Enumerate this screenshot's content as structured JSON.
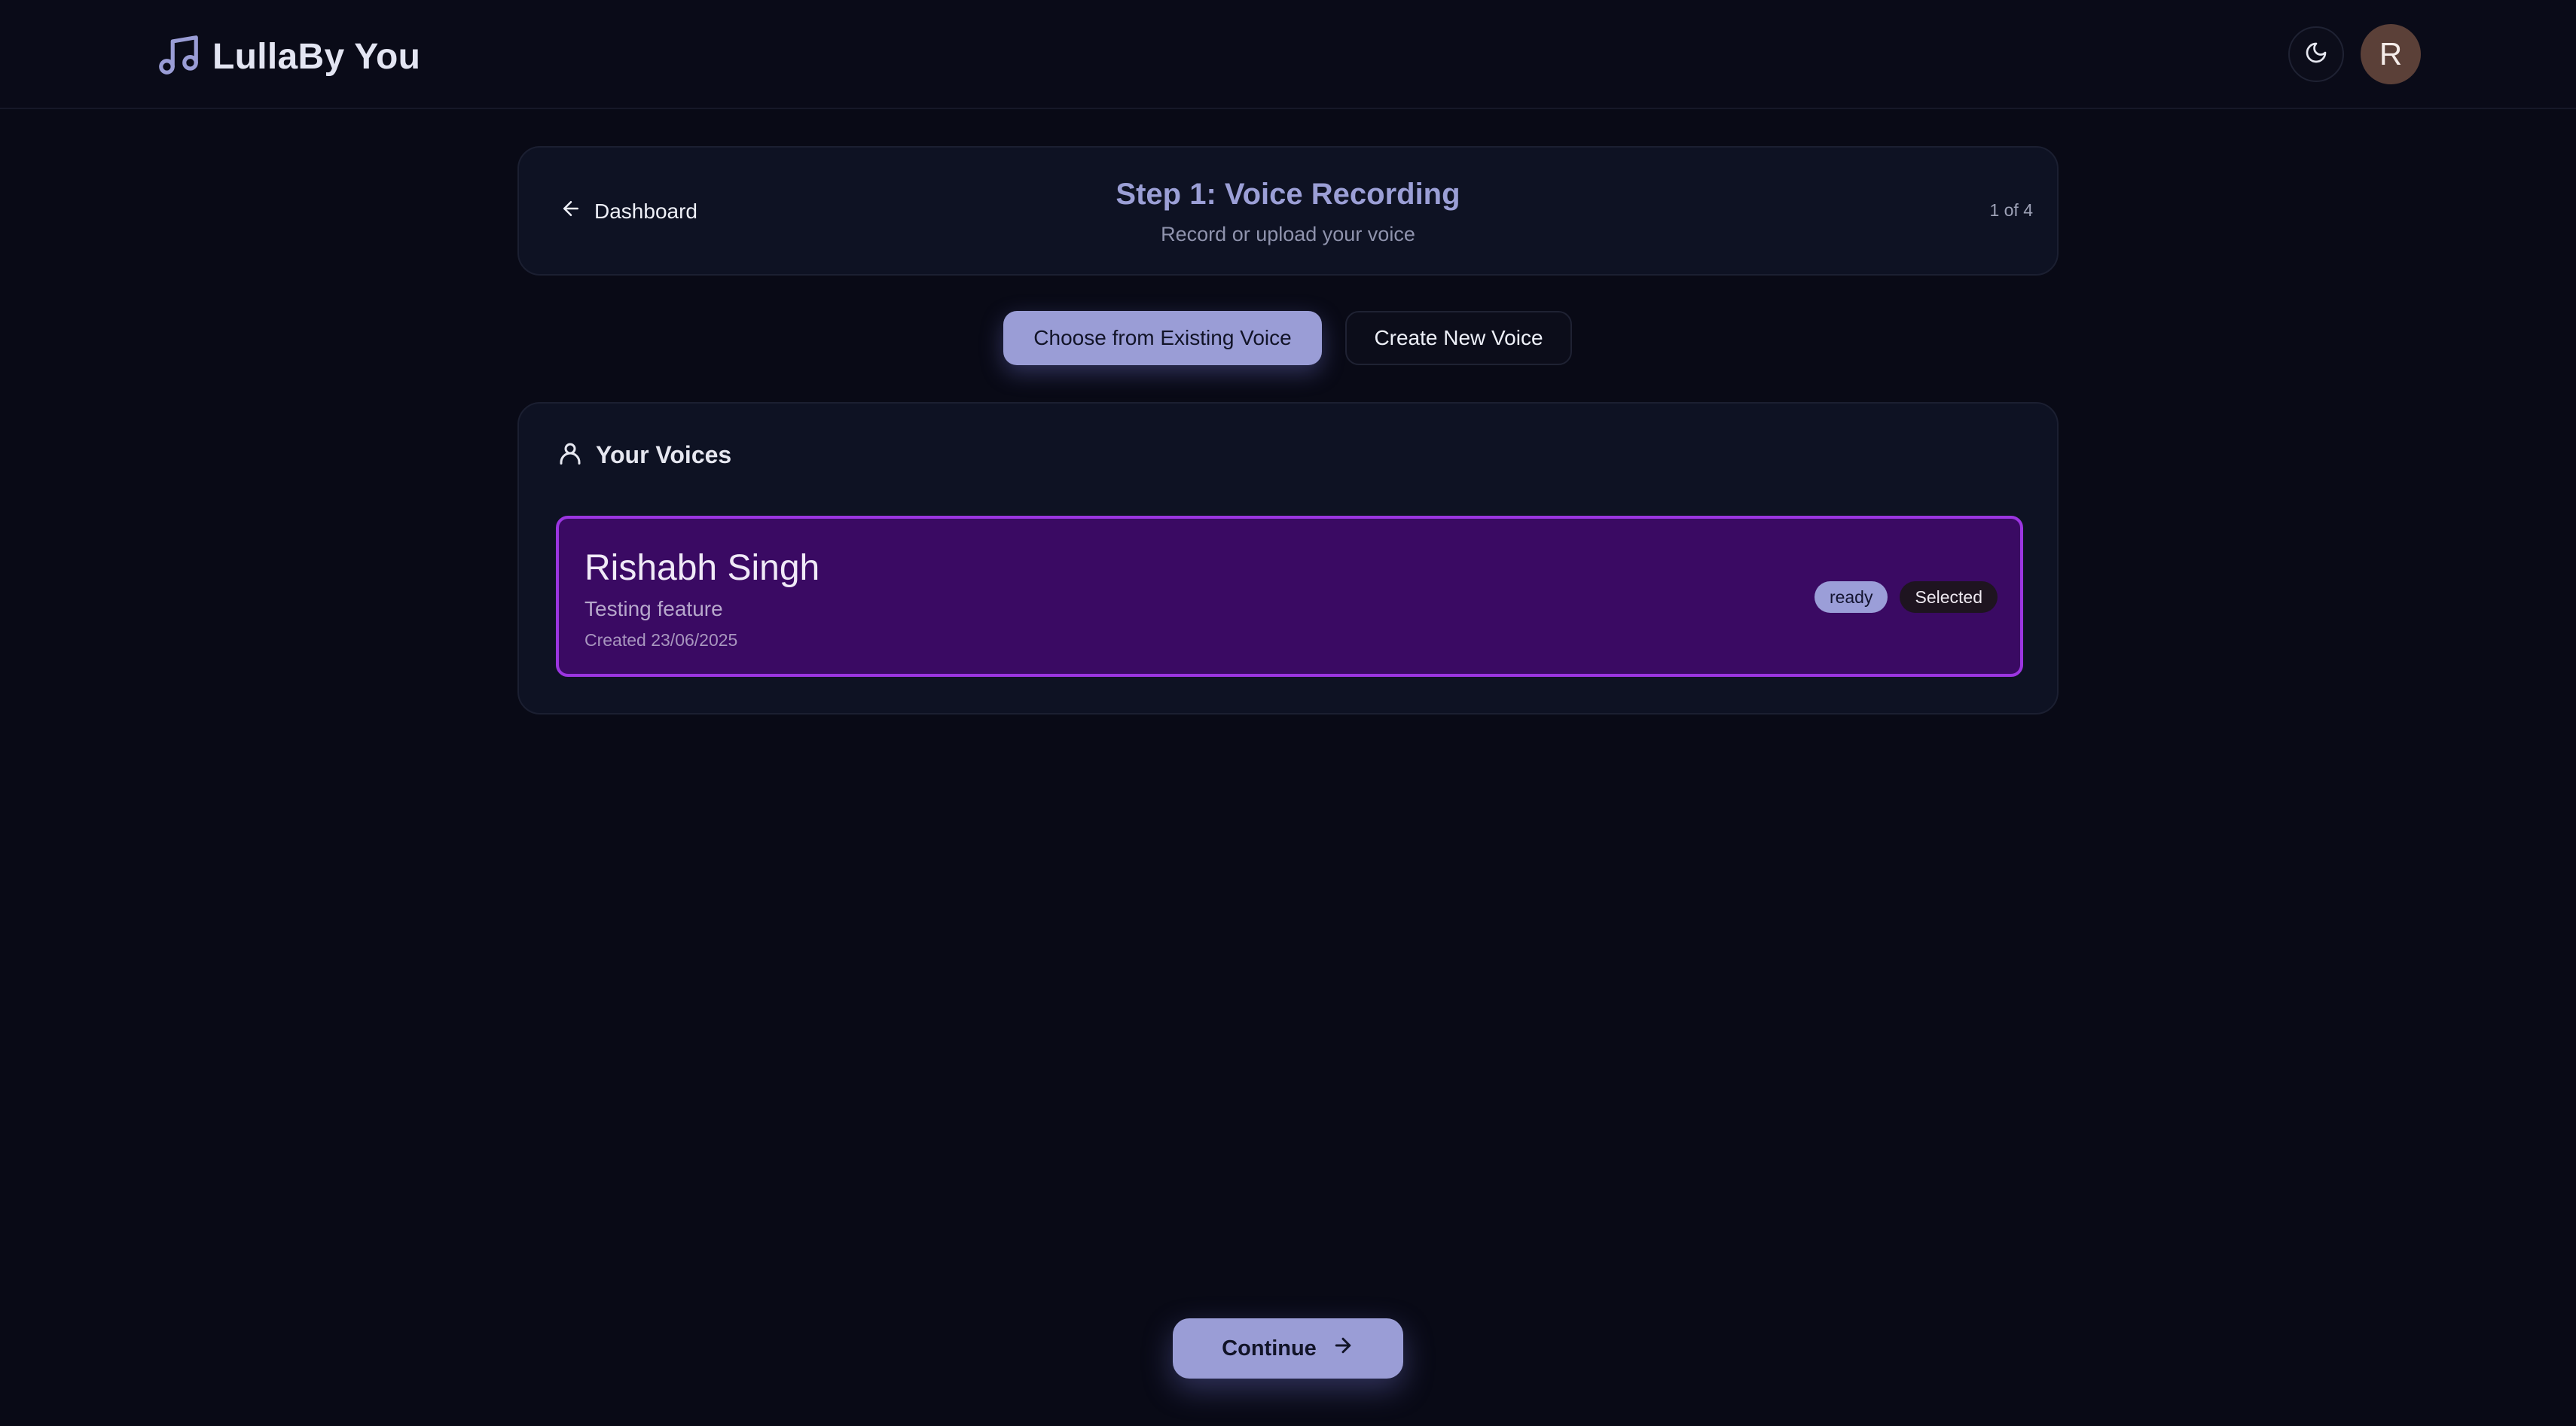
{
  "app": {
    "name": "LullaBy You",
    "avatar_initial": "R"
  },
  "header": {
    "icons": [
      "music-notes-icon",
      "moon-icon"
    ]
  },
  "step": {
    "back_label": "Dashboard",
    "title": "Step 1: Voice Recording",
    "subtitle": "Record or upload your voice",
    "counter": "1 of 4"
  },
  "tabs": {
    "existing_label": "Choose from Existing Voice",
    "create_label": "Create New Voice",
    "active": "existing"
  },
  "voices": {
    "section_title": "Your Voices",
    "items": [
      {
        "name": "Rishabh Singh",
        "description": "Testing feature",
        "created": "Created 23/06/2025",
        "status": "ready",
        "selected_label": "Selected"
      }
    ]
  },
  "footer": {
    "continue_label": "Continue"
  },
  "colors": {
    "background": "#090a16",
    "accent": "#9a9dd6",
    "selected_card": "#3a0a63",
    "selected_border": "#9b35e0"
  }
}
